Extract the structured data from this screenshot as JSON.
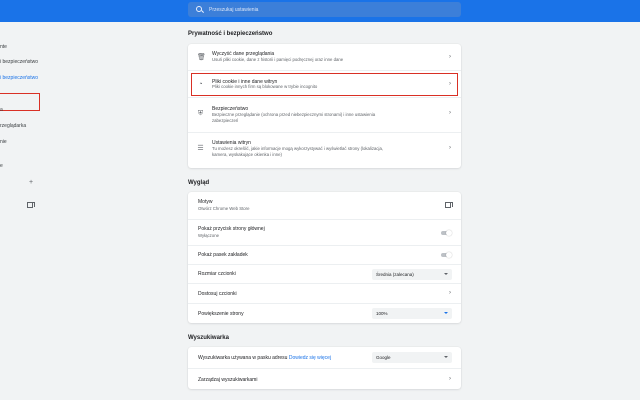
{
  "search": {
    "placeholder": "Przeszukaj ustawienia"
  },
  "sidebar": {
    "items": [
      {
        "label": "nte"
      },
      {
        "label": "i bezpieczeństwo"
      },
      {
        "label": "i bezpieczeństwo"
      },
      {
        "label": "a"
      },
      {
        "label": "rzeglądarka"
      },
      {
        "label": "nie"
      },
      {
        "label": "e"
      }
    ]
  },
  "privacy": {
    "title": "Prywatność i bezpieczeństwo",
    "rows": [
      {
        "icon": "trash-icon",
        "title": "Wyczyść dane przeglądania",
        "sub": "Usuń pliki cookie, dane z historii i pamięci podręcznej oraz inne dane"
      },
      {
        "icon": "cookie-icon",
        "title": "Pliki cookie i inne dane witryn",
        "sub": "Pliki cookie innych firm są blokowane w trybie incognito"
      },
      {
        "icon": "shield-icon",
        "title": "Bezpieczeństwo",
        "sub": "Bezpieczne przeglądanie (ochrona przed niebezpiecznymi stronami) i inne ustawienia",
        "sub2": "zabezpieczeń"
      },
      {
        "icon": "sliders-icon",
        "title": "Ustawienia witryn",
        "sub": "Tu możesz określić, jakie informacje mogą wykorzystywać i wyświetlać strony (lokalizacja,",
        "sub2": "kamera, wyskakujące okienka i inne)"
      }
    ]
  },
  "appearance": {
    "title": "Wygląd",
    "theme_title": "Motyw",
    "theme_sub": "Otwórz Chrome Web Store",
    "home_title": "Pokaż przycisk strony głównej",
    "home_sub": "Wyłączone",
    "bookmarks_title": "Pokaż pasek zakładek",
    "font_size_title": "Rozmiar czcionki",
    "font_size_value": "Średnia (zalecana)",
    "customize_fonts_title": "Dostosuj czcionki",
    "zoom_title": "Powiększenie strony",
    "zoom_value": "100%"
  },
  "search_engine": {
    "title": "Wyszukiwarka",
    "engine_title": "Wyszukiwarka używana w pasku adresu",
    "engine_link": "Dowiedz się więcej",
    "engine_value": "Google",
    "manage_title": "Zarządzaj wyszukiwarkami"
  },
  "colors": {
    "accent": "#1a73e8",
    "highlight": "#d93025",
    "background": "#f1f3f4"
  }
}
